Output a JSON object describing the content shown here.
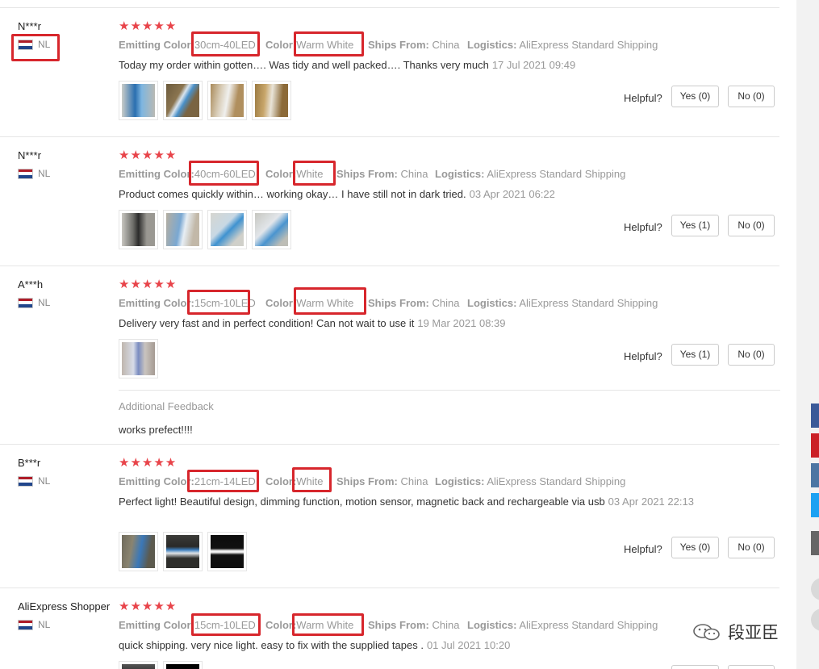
{
  "reviews": [
    {
      "reviewer": "N***r",
      "country": "NL",
      "stars": "★★★★★",
      "props": [
        {
          "label": "Emitting Color:",
          "value": "30cm-40LED"
        },
        {
          "label": "Color:",
          "value": "Warm White"
        },
        {
          "label": "Ships From:",
          "value": "China"
        },
        {
          "label": "Logistics:",
          "value": "AliExpress Standard Shipping"
        }
      ],
      "content": "Today my order within gotten…. Was tidy and well packed…. Thanks very much",
      "date": "17 Jul 2021 09:49",
      "helpful_label": "Helpful?",
      "yes_label": "Yes (0)",
      "no_label": "No (0)",
      "thumb_count": 4
    },
    {
      "reviewer": "N***r",
      "country": "NL",
      "stars": "★★★★★",
      "props": [
        {
          "label": "Emitting Color:",
          "value": "40cm-60LED"
        },
        {
          "label": "Color:",
          "value": "White"
        },
        {
          "label": "Ships From:",
          "value": "China"
        },
        {
          "label": "Logistics:",
          "value": "AliExpress Standard Shipping"
        }
      ],
      "content": "Product comes quickly within… working okay… I have still not in dark tried.",
      "date": "03 Apr 2021 06:22",
      "helpful_label": "Helpful?",
      "yes_label": "Yes (1)",
      "no_label": "No (0)",
      "thumb_count": 4
    },
    {
      "reviewer": "A***h",
      "country": "NL",
      "stars": "★★★★★",
      "props": [
        {
          "label": "Emitting Color:",
          "value": "15cm-10LED"
        },
        {
          "label": "Color:",
          "value": "Warm White"
        },
        {
          "label": "Ships From:",
          "value": "China"
        },
        {
          "label": "Logistics:",
          "value": "AliExpress Standard Shipping"
        }
      ],
      "content": "Delivery very fast and in perfect condition! Can not wait to use it",
      "date": "19 Mar 2021 08:39",
      "helpful_label": "Helpful?",
      "yes_label": "Yes (1)",
      "no_label": "No (0)",
      "thumb_count": 1,
      "additional_feedback_label": "Additional Feedback",
      "additional_feedback": "works prefect!!!!"
    },
    {
      "reviewer": "B***r",
      "country": "NL",
      "stars": "★★★★★",
      "props": [
        {
          "label": "Emitting Color:",
          "value": "21cm-14LED"
        },
        {
          "label": "Color:",
          "value": "White"
        },
        {
          "label": "Ships From:",
          "value": "China"
        },
        {
          "label": "Logistics:",
          "value": "AliExpress Standard Shipping"
        }
      ],
      "content": "Perfect light! Beautiful design, dimming function, motion sensor, magnetic back and rechargeable via usb",
      "date": "03 Apr 2021 22:13",
      "helpful_label": "Helpful?",
      "yes_label": "Yes (0)",
      "no_label": "No (0)",
      "thumb_count": 3
    },
    {
      "reviewer": "AliExpress Shopper",
      "country": "NL",
      "stars": "★★★★★",
      "props": [
        {
          "label": "Emitting Color:",
          "value": "15cm-10LED"
        },
        {
          "label": "Color:",
          "value": "Warm White"
        },
        {
          "label": "Ships From:",
          "value": "China"
        },
        {
          "label": "Logistics:",
          "value": "AliExpress Standard Shipping"
        }
      ],
      "content": "quick shipping. very nice light. easy to fix with the supplied tapes .",
      "date": "01 Jul 2021 10:20",
      "thumb_count": 2
    }
  ],
  "watermark": {
    "text": "段亚臣",
    "icon": "wechat-icon"
  },
  "colors": {
    "star": "#e8444a",
    "highlight": "#d7262c",
    "flag_red": "#ae1c28",
    "flag_blue": "#21468b"
  },
  "share_icons": [
    "facebook-icon",
    "pinterest-icon",
    "vk-icon",
    "twitter-icon",
    "more-icon"
  ]
}
